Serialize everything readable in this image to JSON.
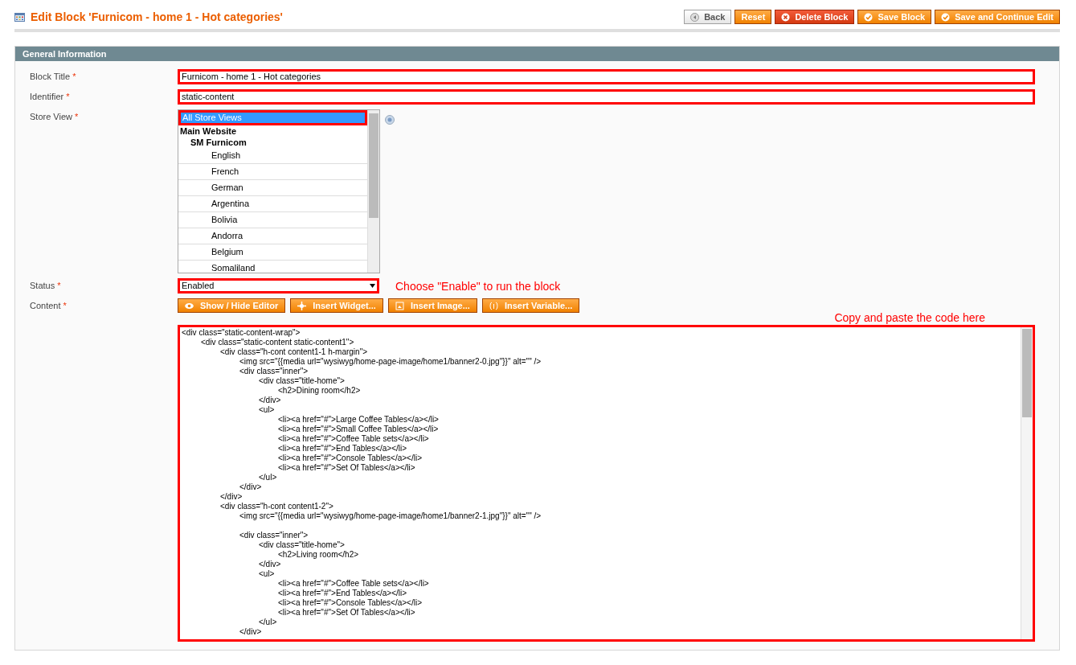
{
  "page": {
    "title": "Edit Block 'Furnicom - home 1 - Hot categories'"
  },
  "actions": [
    {
      "label": "Back",
      "kind": "back"
    },
    {
      "label": "Reset",
      "kind": "plain"
    },
    {
      "label": "Delete Block",
      "kind": "delete"
    },
    {
      "label": "Save Block",
      "kind": "save"
    },
    {
      "label": "Save and Continue Edit",
      "kind": "save"
    }
  ],
  "section": {
    "title": "General Information"
  },
  "fields": [
    {
      "label": "Block Title",
      "required_mark": "*",
      "kind": "text",
      "value": "Furnicom - home 1 -  Hot categories"
    },
    {
      "label": "Identifier",
      "required_mark": "*",
      "kind": "text",
      "value": "static-content"
    },
    {
      "label": "Store View",
      "required_mark": "*",
      "kind": "multiselect",
      "options": [
        {
          "label": "All Store Views",
          "selected": true
        },
        {
          "label": "Main Website",
          "selected": false,
          "children": [
            {
              "label": "SM Furnicom",
              "selected": false,
              "children": [
                {
                  "label": "English",
                  "selected": false
                },
                {
                  "label": "French",
                  "selected": false
                },
                {
                  "label": "German",
                  "selected": false
                },
                {
                  "label": "Argentina",
                  "selected": false
                },
                {
                  "label": "Bolivia",
                  "selected": false
                },
                {
                  "label": "Andorra",
                  "selected": false
                },
                {
                  "label": "Belgium",
                  "selected": false
                },
                {
                  "label": "Somaliland",
                  "selected": false
                }
              ]
            }
          ]
        }
      ]
    },
    {
      "label": "Status",
      "required_mark": "*",
      "kind": "select",
      "value": "Enabled",
      "note": "Choose \"Enable\" to run the block"
    },
    {
      "label": "Content",
      "required_mark": "*",
      "kind": "editor",
      "note": "Copy and paste the code here",
      "buttons": [
        {
          "label": "Show / Hide Editor",
          "kind": "eye"
        },
        {
          "label": "Insert Widget...",
          "kind": "widget"
        },
        {
          "label": "Insert Image...",
          "kind": "image"
        },
        {
          "label": "Insert Variable...",
          "kind": "variable"
        }
      ],
      "value": "<div class=\"static-content-wrap\">\n\t<div class=\"static-content static-content1\">\n\t\t<div class=\"h-cont content1-1 h-margin\">\n\t\t\t<img src=\"{{media url=\"wysiwyg/home-page-image/home1/banner2-0.jpg\"}}\" alt=\"\" />\n\t\t\t<div class=\"inner\">\n\t\t\t\t<div class=\"title-home\">\n\t\t\t\t\t<h2>Dining room</h2>\n\t\t\t\t</div>\n\t\t\t\t<ul>\n\t\t\t\t\t<li><a href=\"#\">Large Coffee Tables</a></li>\n\t\t\t\t\t<li><a href=\"#\">Small Coffee Tables</a></li>\n\t\t\t\t\t<li><a href=\"#\">Coffee Table sets</a></li>\n\t\t\t\t\t<li><a href=\"#\">End Tables</a></li>\n\t\t\t\t\t<li><a href=\"#\">Console Tables</a></li>\n\t\t\t\t\t<li><a href=\"#\">Set Of Tables</a></li>\n\t\t\t\t</ul>\n\t\t\t</div>\n\t\t</div>\n\t\t<div class=\"h-cont content1-2\">\n\t\t\t<img src=\"{{media url=\"wysiwyg/home-page-image/home1/banner2-1.jpg\"}}\" alt=\"\" />\n\n\t\t\t<div class=\"inner\">\n\t\t\t\t<div class=\"title-home\">\n\t\t\t\t\t<h2>Living room</h2>\n\t\t\t\t</div>\n\t\t\t\t<ul>\n\t\t\t\t\t<li><a href=\"#\">Coffee Table sets</a></li>\n\t\t\t\t\t<li><a href=\"#\">End Tables</a></li>\n\t\t\t\t\t<li><a href=\"#\">Console Tables</a></li>\n\t\t\t\t\t<li><a href=\"#\">Set Of Tables</a></li>\n\t\t\t\t</ul>\n\t\t\t</div>"
    }
  ]
}
